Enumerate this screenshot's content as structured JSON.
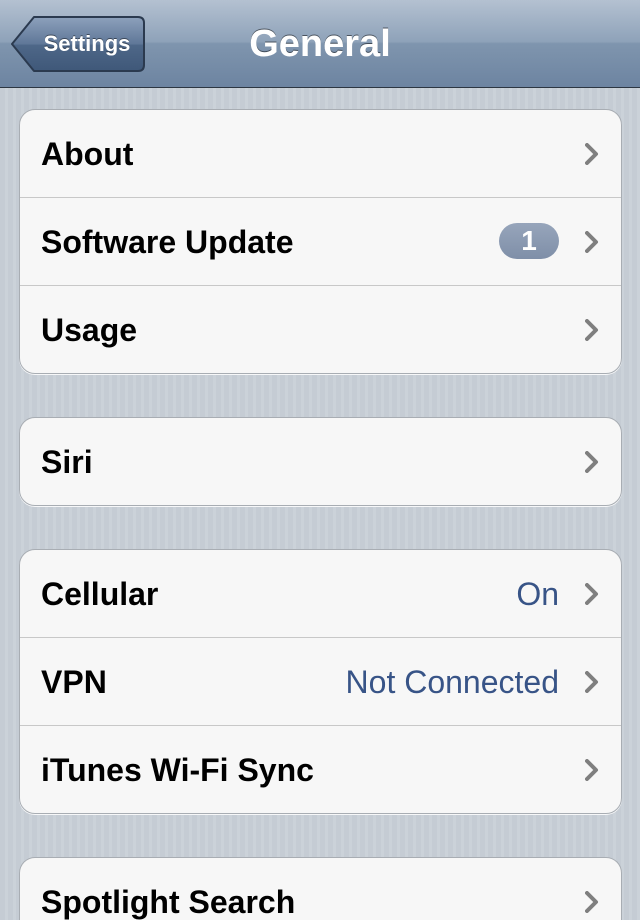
{
  "navbar": {
    "back_label": "Settings",
    "title": "General"
  },
  "groups": [
    {
      "rows": [
        {
          "label": "About"
        },
        {
          "label": "Software Update",
          "badge": "1"
        },
        {
          "label": "Usage"
        }
      ]
    },
    {
      "rows": [
        {
          "label": "Siri"
        }
      ]
    },
    {
      "rows": [
        {
          "label": "Cellular",
          "value": "On"
        },
        {
          "label": "VPN",
          "value": "Not Connected"
        },
        {
          "label": "iTunes Wi-Fi Sync"
        }
      ]
    },
    {
      "rows": [
        {
          "label": "Spotlight Search"
        }
      ]
    }
  ],
  "icons": {
    "disclosure": "chevron-right-icon"
  },
  "colors": {
    "navbar": "#6d84a1",
    "detail_text": "#385487",
    "badge": "#8a99b1",
    "chevron": "#7f7f7f"
  }
}
